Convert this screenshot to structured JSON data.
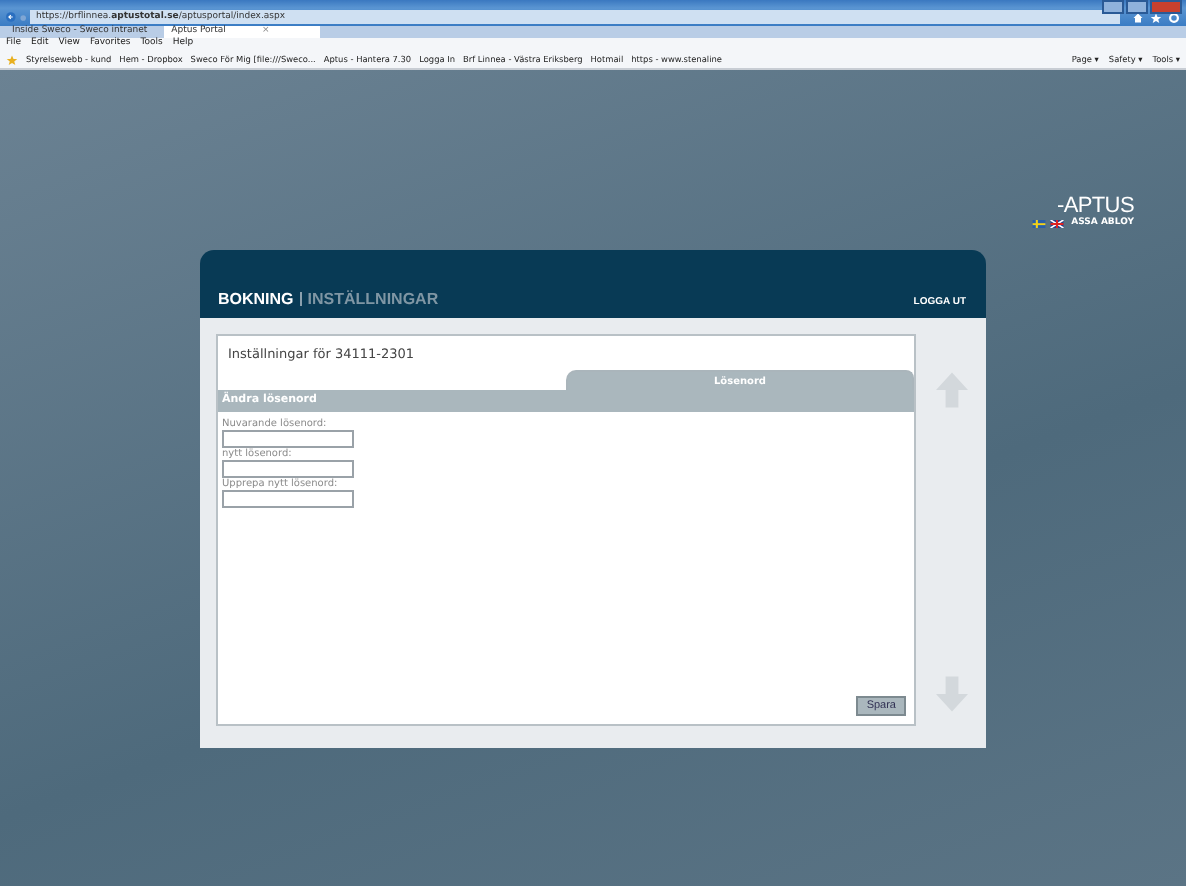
{
  "browser": {
    "url_prefix": "https://brflinnea.",
    "url_domain": "aptustotal.se",
    "url_path": "/aptusportal/index.aspx",
    "tabs": [
      {
        "label": "Inside Sweco - Sweco intranet",
        "selected": false
      },
      {
        "label": "Aptus Portal",
        "selected": true,
        "close": "×"
      }
    ],
    "menu": [
      "File",
      "Edit",
      "View",
      "Favorites",
      "Tools",
      "Help"
    ],
    "favorites": [
      "Styrelsewebb - kund",
      "Hem - Dropbox",
      "Sweco För Mig [file:///Sweco...",
      "Aptus - Hantera 7.30",
      "Logga In",
      "Brf Linnea - Västra Eriksberg",
      "Hotmail",
      "https - www.stenaline"
    ],
    "commands": [
      "Page ▾",
      "Safety ▾",
      "Tools ▾"
    ]
  },
  "brand": {
    "logo": "-APTUS",
    "sub": "ASSA ABLOY"
  },
  "nav": [
    {
      "label": "BOKNING",
      "selected": true
    },
    {
      "label": "INSTÄLLNINGAR",
      "selected": false
    }
  ],
  "logout": "LOGGA UT",
  "settings_title": "Inställningar för 34111-2301",
  "tab": {
    "label": "Lösenord",
    "selected": true
  },
  "section": "Ändra lösenord",
  "fields": [
    {
      "label": "Nuvarande lösenord:"
    },
    {
      "label": "nytt lösenord:"
    },
    {
      "label": "Upprepa nytt lösenord:"
    }
  ],
  "save": "Spara"
}
